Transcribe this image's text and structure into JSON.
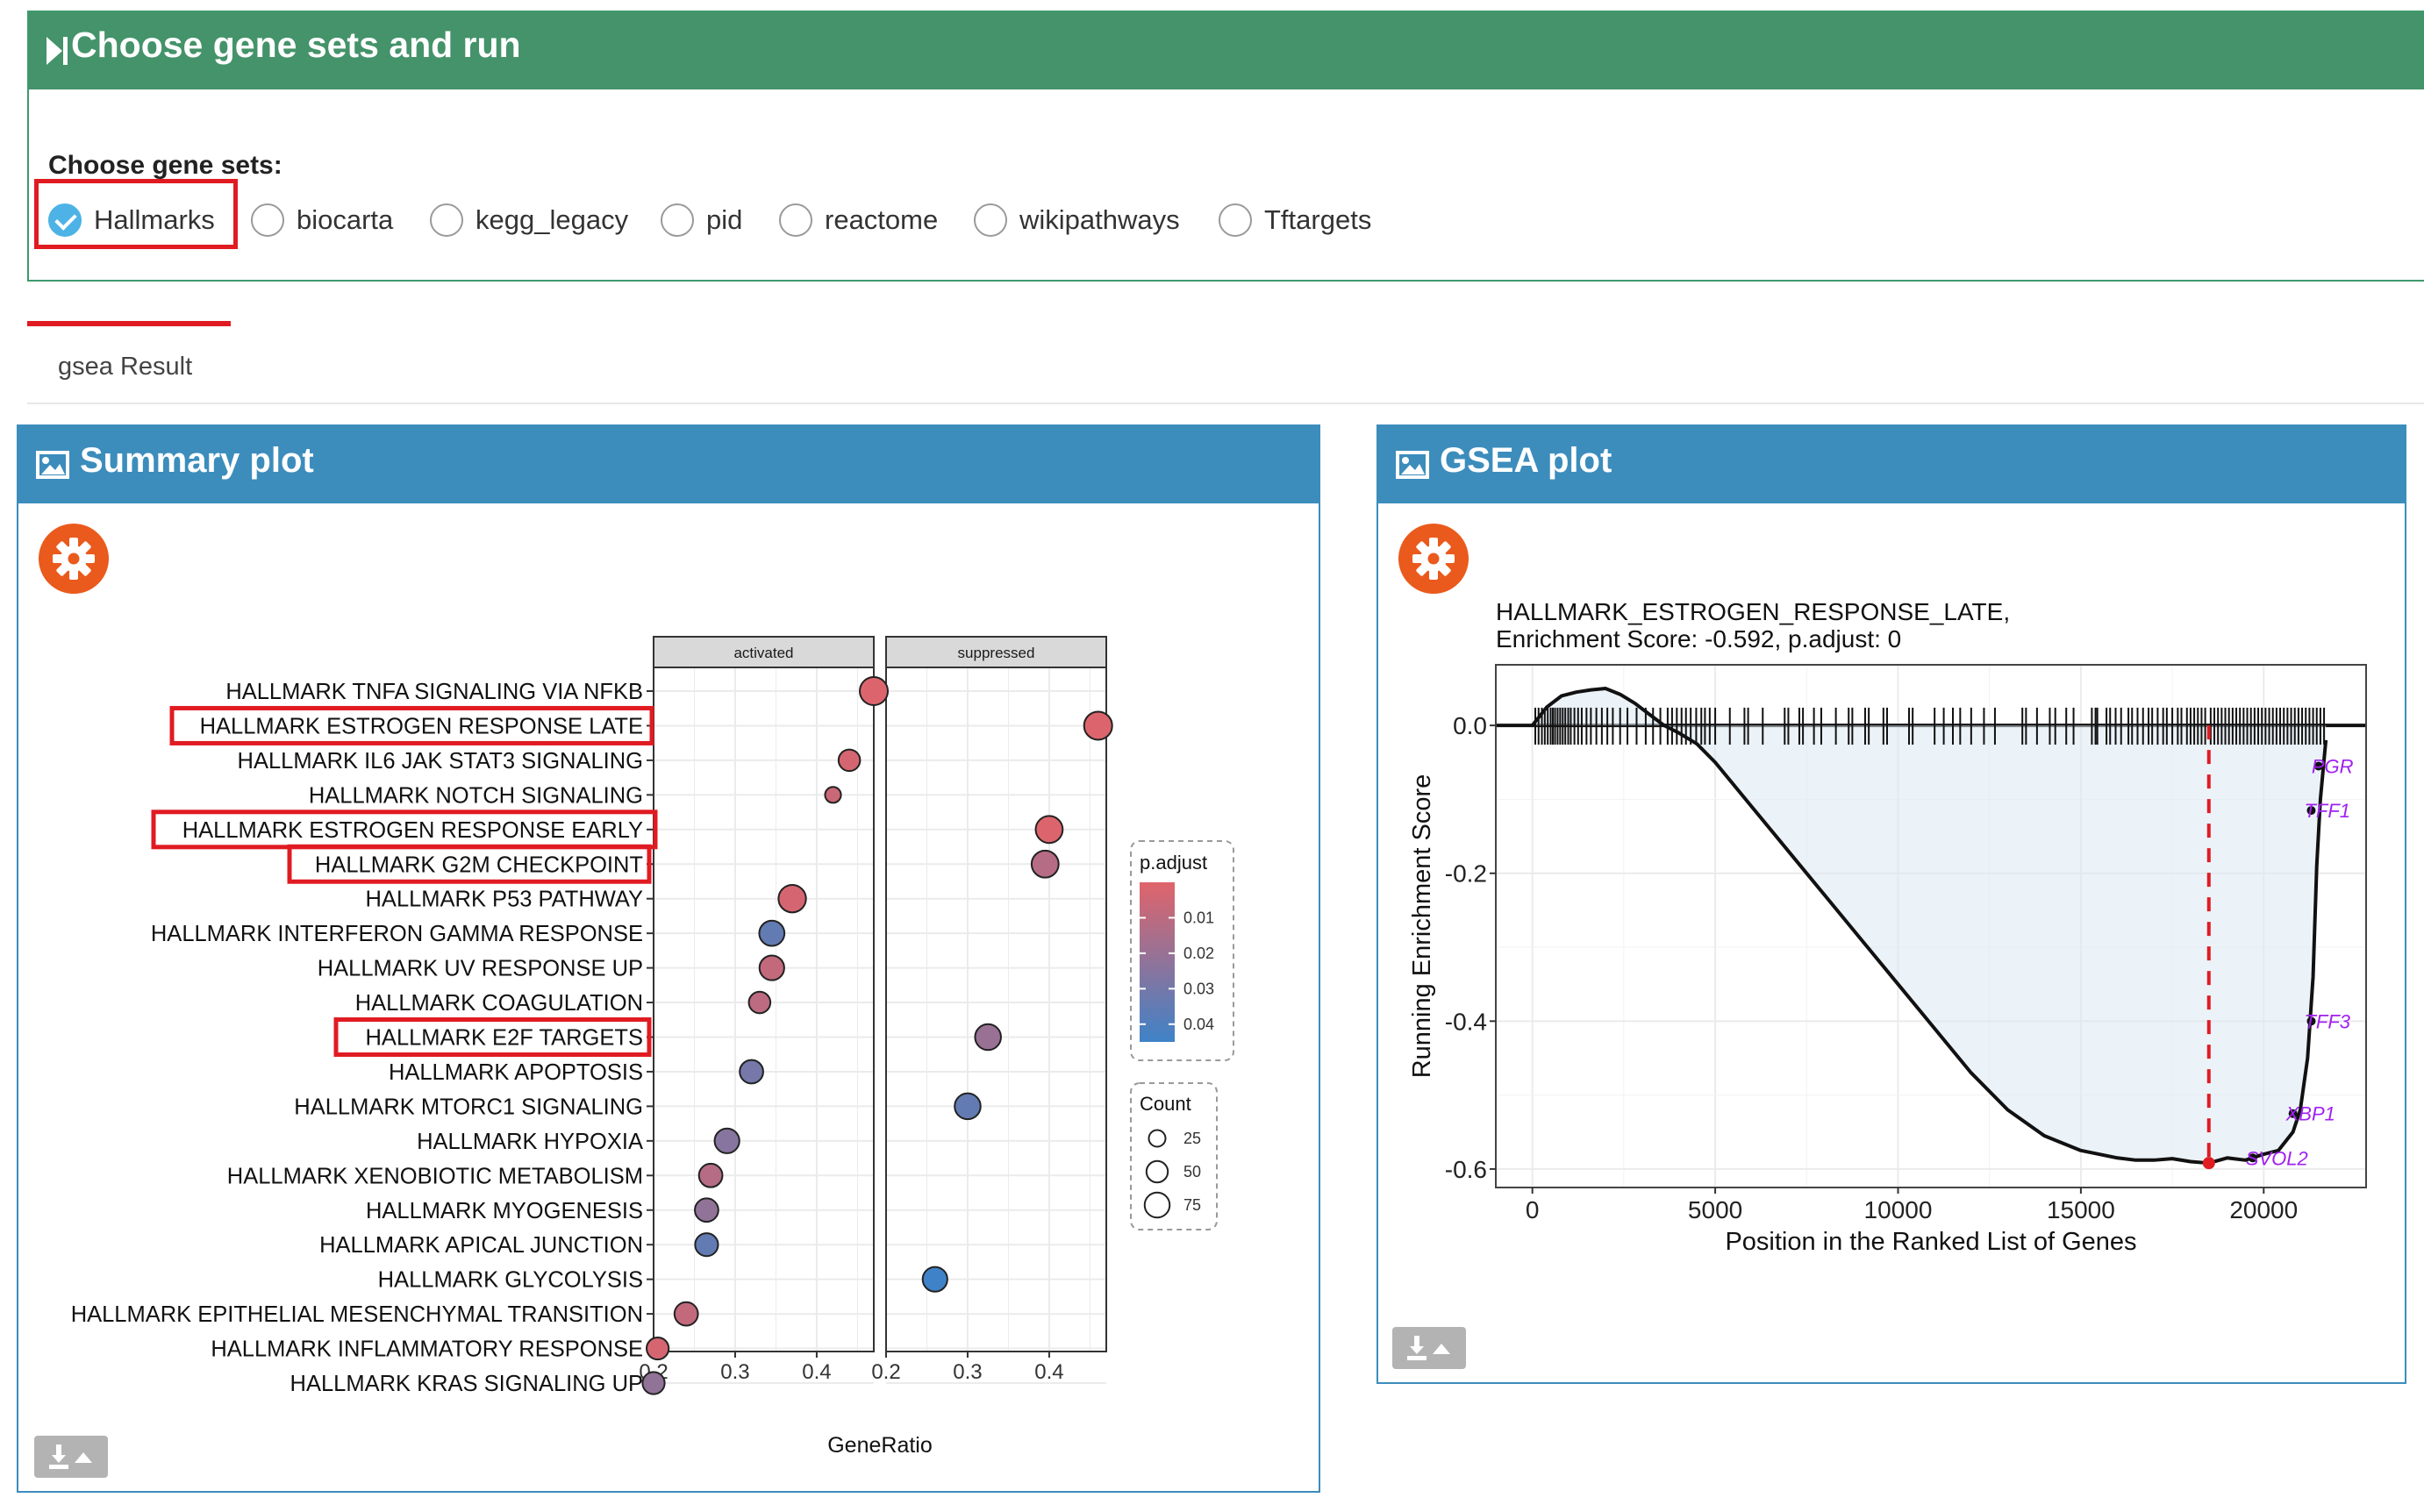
{
  "top_panel": {
    "title": "Choose gene sets and run",
    "choose_label": "Choose gene sets:",
    "options": [
      {
        "label": "Hallmarks",
        "checked": true
      },
      {
        "label": "biocarta",
        "checked": false
      },
      {
        "label": "kegg_legacy",
        "checked": false
      },
      {
        "label": "pid",
        "checked": false
      },
      {
        "label": "reactome",
        "checked": false
      },
      {
        "label": "wikipathways",
        "checked": false
      },
      {
        "label": "Tftargets",
        "checked": false
      }
    ]
  },
  "tabs": {
    "active": "gsea Result"
  },
  "summary_box": {
    "title": "Summary plot",
    "icon": "image-icon",
    "settings_icon": "gear-icon",
    "download_icon": "download-icon"
  },
  "gsea_box": {
    "title": "GSEA plot",
    "icon": "image-icon",
    "settings_icon": "gear-icon",
    "download_icon": "download-icon"
  },
  "colors": {
    "green_header": "#44936a",
    "blue_header": "#3c8dbc",
    "gear": "#ea5a1c",
    "highlight": "#e01b22",
    "check": "#4db3e6",
    "gene_label": "#a020f0"
  },
  "chart_data": [
    {
      "type": "scatter",
      "facets": [
        "activated",
        "suppressed"
      ],
      "xlabel": "GeneRatio",
      "xlim": [
        0.2,
        0.47
      ],
      "xticks": [
        "0.2",
        "0.3",
        "0.4"
      ],
      "legend_color": {
        "title": "p.adjust",
        "ticks": [
          "0.01",
          "0.02",
          "0.03",
          "0.04"
        ],
        "min": 0.0,
        "max": 0.045,
        "low_color": "#e0646b",
        "high_color": "#3f82c8"
      },
      "legend_size": {
        "title": "Count",
        "ticks": [
          "25",
          "50",
          "75"
        ]
      },
      "highlighted": [
        "HALLMARK ESTROGEN RESPONSE LATE",
        "HALLMARK ESTROGEN RESPONSE EARLY",
        "HALLMARK G2M CHECKPOINT",
        "HALLMARK E2F TARGETS"
      ],
      "points": [
        {
          "term": "HALLMARK TNFA SIGNALING VIA NFKB",
          "facet": "activated",
          "ratio": 0.47,
          "padj": 0.001,
          "count": 55
        },
        {
          "term": "HALLMARK ESTROGEN RESPONSE LATE",
          "facet": "suppressed",
          "ratio": 0.46,
          "padj": 0.001,
          "count": 55
        },
        {
          "term": "HALLMARK IL6 JAK STAT3 SIGNALING",
          "facet": "activated",
          "ratio": 0.44,
          "padj": 0.003,
          "count": 28
        },
        {
          "term": "HALLMARK NOTCH SIGNALING",
          "facet": "activated",
          "ratio": 0.42,
          "padj": 0.006,
          "count": 12
        },
        {
          "term": "HALLMARK ESTROGEN RESPONSE EARLY",
          "facet": "suppressed",
          "ratio": 0.4,
          "padj": 0.001,
          "count": 50
        },
        {
          "term": "HALLMARK G2M CHECKPOINT",
          "facet": "suppressed",
          "ratio": 0.395,
          "padj": 0.012,
          "count": 50
        },
        {
          "term": "HALLMARK P53 PATHWAY",
          "facet": "activated",
          "ratio": 0.37,
          "padj": 0.003,
          "count": 52
        },
        {
          "term": "HALLMARK INTERFERON GAMMA RESPONSE",
          "facet": "activated",
          "ratio": 0.345,
          "padj": 0.035,
          "count": 42
        },
        {
          "term": "HALLMARK UV RESPONSE UP",
          "facet": "activated",
          "ratio": 0.345,
          "padj": 0.008,
          "count": 40
        },
        {
          "term": "HALLMARK COAGULATION",
          "facet": "activated",
          "ratio": 0.33,
          "padj": 0.01,
          "count": 28
        },
        {
          "term": "HALLMARK E2F TARGETS",
          "facet": "suppressed",
          "ratio": 0.325,
          "padj": 0.02,
          "count": 45
        },
        {
          "term": "HALLMARK APOPTOSIS",
          "facet": "activated",
          "ratio": 0.32,
          "padj": 0.03,
          "count": 35
        },
        {
          "term": "HALLMARK MTORC1 SIGNALING",
          "facet": "suppressed",
          "ratio": 0.3,
          "padj": 0.035,
          "count": 45
        },
        {
          "term": "HALLMARK HYPOXIA",
          "facet": "activated",
          "ratio": 0.29,
          "padj": 0.025,
          "count": 40
        },
        {
          "term": "HALLMARK XENOBIOTIC METABOLISM",
          "facet": "activated",
          "ratio": 0.27,
          "padj": 0.012,
          "count": 35
        },
        {
          "term": "HALLMARK MYOGENESIS",
          "facet": "activated",
          "ratio": 0.265,
          "padj": 0.022,
          "count": 35
        },
        {
          "term": "HALLMARK APICAL JUNCTION",
          "facet": "activated",
          "ratio": 0.265,
          "padj": 0.035,
          "count": 33
        },
        {
          "term": "HALLMARK GLYCOLYSIS",
          "facet": "suppressed",
          "ratio": 0.26,
          "padj": 0.045,
          "count": 40
        },
        {
          "term": "HALLMARK EPITHELIAL MESENCHYMAL TRANSITION",
          "facet": "activated",
          "ratio": 0.24,
          "padj": 0.008,
          "count": 35
        },
        {
          "term": "HALLMARK INFLAMMATORY RESPONSE",
          "facet": "activated",
          "ratio": 0.205,
          "padj": 0.003,
          "count": 30
        },
        {
          "term": "HALLMARK KRAS SIGNALING UP",
          "facet": "activated",
          "ratio": 0.2,
          "padj": 0.022,
          "count": 30
        }
      ]
    },
    {
      "type": "line",
      "title": "HALLMARK_ESTROGEN_RESPONSE_LATE,",
      "subtitle": "Enrichment Score: -0.592, p.adjust: 0",
      "xlabel": "Position in the Ranked List of Genes",
      "ylabel": "Running Enrichment Score",
      "xlim": [
        -1000,
        22800
      ],
      "ylim": [
        -0.625,
        0.082
      ],
      "xticks": [
        "0",
        "5000",
        "10000",
        "15000",
        "20000"
      ],
      "yticks": [
        "0.0",
        "-0.2",
        "-0.4",
        "-0.6"
      ],
      "enrichment_score": -0.592,
      "peak_position": 18500,
      "series": [
        {
          "x": [
            0,
            400,
            800,
            1200,
            1600,
            2000,
            2400,
            2800,
            3200,
            3600,
            4000,
            4500,
            5000,
            6000,
            7000,
            8000,
            9000,
            10000,
            11000,
            12000,
            13000,
            14000,
            15000,
            16000,
            16500,
            17000,
            17500,
            18000,
            18500,
            19000,
            19500,
            20000,
            20400,
            20800,
            21000,
            21200,
            21350,
            21450,
            21550,
            21700
          ],
          "y": [
            0.0,
            0.025,
            0.04,
            0.045,
            0.048,
            0.05,
            0.042,
            0.03,
            0.015,
            0.0,
            -0.01,
            -0.025,
            -0.05,
            -0.11,
            -0.17,
            -0.23,
            -0.29,
            -0.35,
            -0.41,
            -0.47,
            -0.52,
            -0.555,
            -0.575,
            -0.585,
            -0.588,
            -0.588,
            -0.586,
            -0.59,
            -0.592,
            -0.585,
            -0.588,
            -0.58,
            -0.575,
            -0.55,
            -0.52,
            -0.45,
            -0.34,
            -0.19,
            -0.1,
            -0.02
          ]
        }
      ],
      "gene_labels": [
        {
          "label": "PGR",
          "x": 21500,
          "y": -0.055
        },
        {
          "label": "TFF1",
          "x": 21300,
          "y": -0.115
        },
        {
          "label": "TFF3",
          "x": 21300,
          "y": -0.4
        },
        {
          "label": "XBP1",
          "x": 20800,
          "y": -0.525
        },
        {
          "label": "SVOL2",
          "x": 19700,
          "y": -0.585
        }
      ],
      "hits": [
        80,
        170,
        260,
        340,
        420,
        500,
        560,
        620,
        690,
        760,
        830,
        900,
        980,
        1050,
        1150,
        1250,
        1350,
        1480,
        1600,
        1750,
        1900,
        2050,
        2200,
        2400,
        2600,
        2850,
        3100,
        3300,
        3500,
        3700,
        3820,
        3950,
        4080,
        4200,
        4330,
        4480,
        4620,
        4720,
        4850,
        5000,
        5400,
        5800,
        5900,
        6300,
        6900,
        7000,
        7300,
        7400,
        7700,
        7900,
        8300,
        8650,
        8750,
        9100,
        9200,
        9600,
        9700,
        10300,
        10400,
        11000,
        11250,
        11500,
        11700,
        12000,
        12350,
        12650,
        13400,
        13500,
        13800,
        14150,
        14300,
        14600,
        14800,
        15300,
        15400,
        15450,
        15700,
        15800,
        15950,
        16100,
        16300,
        16400,
        16550,
        16700,
        16850,
        16950,
        17100,
        17250,
        17350,
        17500,
        17650,
        17750,
        17900,
        18000,
        18100,
        18200,
        18300,
        18400,
        18550,
        18650,
        18750,
        18850,
        18950,
        19050,
        19150,
        19250,
        19350,
        19450,
        19550,
        19650,
        19750,
        19850,
        19950,
        20050,
        20150,
        20250,
        20350,
        20450,
        20550,
        20650,
        20750,
        20850,
        20950,
        21050,
        21150,
        21250,
        21350,
        21450,
        21550,
        21650
      ]
    }
  ]
}
